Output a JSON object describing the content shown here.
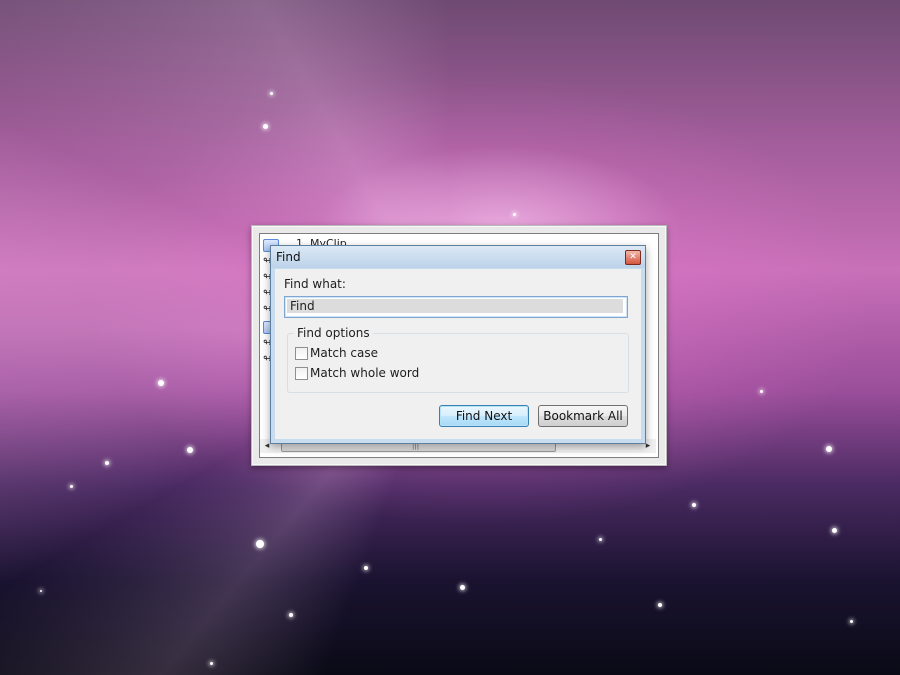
{
  "clip_list": {
    "first_item_label": "MyClip",
    "first_item_number": "1."
  },
  "find_dialog": {
    "title": "Find",
    "find_what_label": "Find what:",
    "search_value": "Find",
    "options_label": "Find options",
    "match_case_label": "Match case",
    "match_case_checked": false,
    "match_whole_word_label": "Match whole word",
    "match_whole_word_checked": false,
    "find_next_label": "Find Next",
    "bookmark_all_label": "Bookmark All"
  },
  "colors": {
    "title_bar": "#c8dcef",
    "default_button_border": "#3c7fb1",
    "close_button": "#d4563f"
  },
  "icons": {
    "close": "close-icon",
    "clip_item": "clip-icon",
    "scroll_left": "arrow-left-icon",
    "scroll_right": "arrow-right-icon"
  }
}
